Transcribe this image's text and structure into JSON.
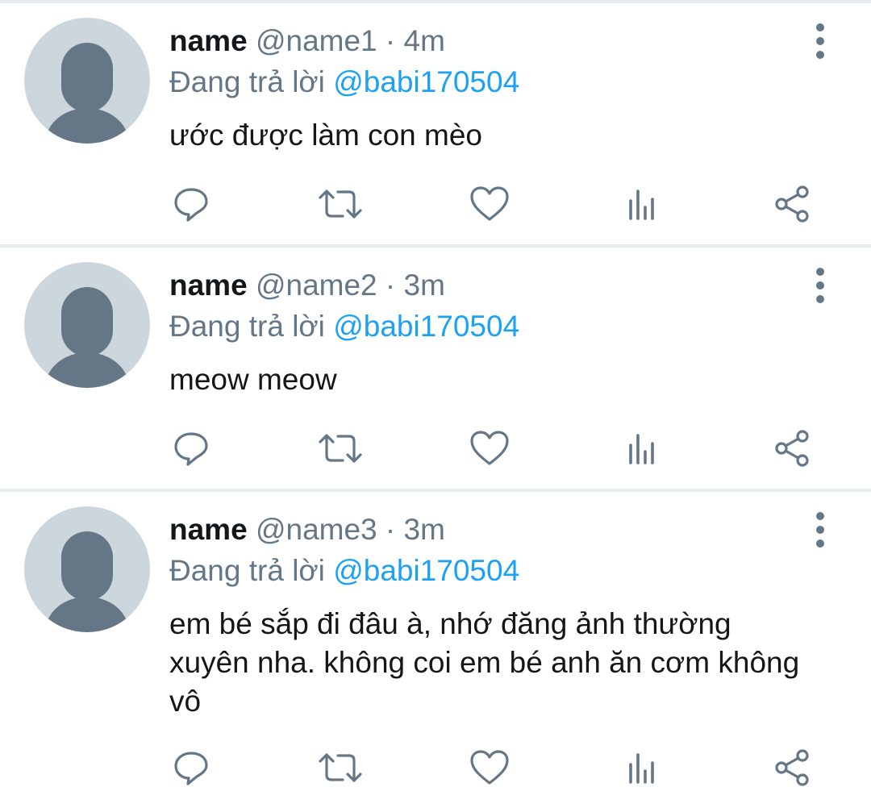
{
  "tweets": [
    {
      "name": "name",
      "handle": "@name1",
      "separator": "·",
      "time": "4m",
      "reply_prefix": "Đang trả lời",
      "reply_to": "@babi170504",
      "text": "ước được làm con mèo"
    },
    {
      "name": "name",
      "handle": "@name2",
      "separator": "·",
      "time": "3m",
      "reply_prefix": "Đang trả lời",
      "reply_to": "@babi170504",
      "text": "meow meow"
    },
    {
      "name": "name",
      "handle": "@name3",
      "separator": "·",
      "time": "3m",
      "reply_prefix": "Đang trả lời",
      "reply_to": "@babi170504",
      "text": "em bé sắp đi đâu à, nhớ đăng ảnh thường xuyên nha. không coi em bé anh ăn cơm không vô"
    }
  ],
  "icons": {
    "avatar": "default-avatar-icon",
    "more": "more-vertical-icon",
    "reply": "reply-icon",
    "retweet": "retweet-icon",
    "like": "heart-icon",
    "stats": "analytics-icon",
    "share": "share-icon"
  },
  "colors": {
    "name": "#14171a",
    "secondary": "#657786",
    "mention": "#1da1f2",
    "avatar_bg": "#ccd6dd",
    "divider": "#e6ecf0"
  }
}
